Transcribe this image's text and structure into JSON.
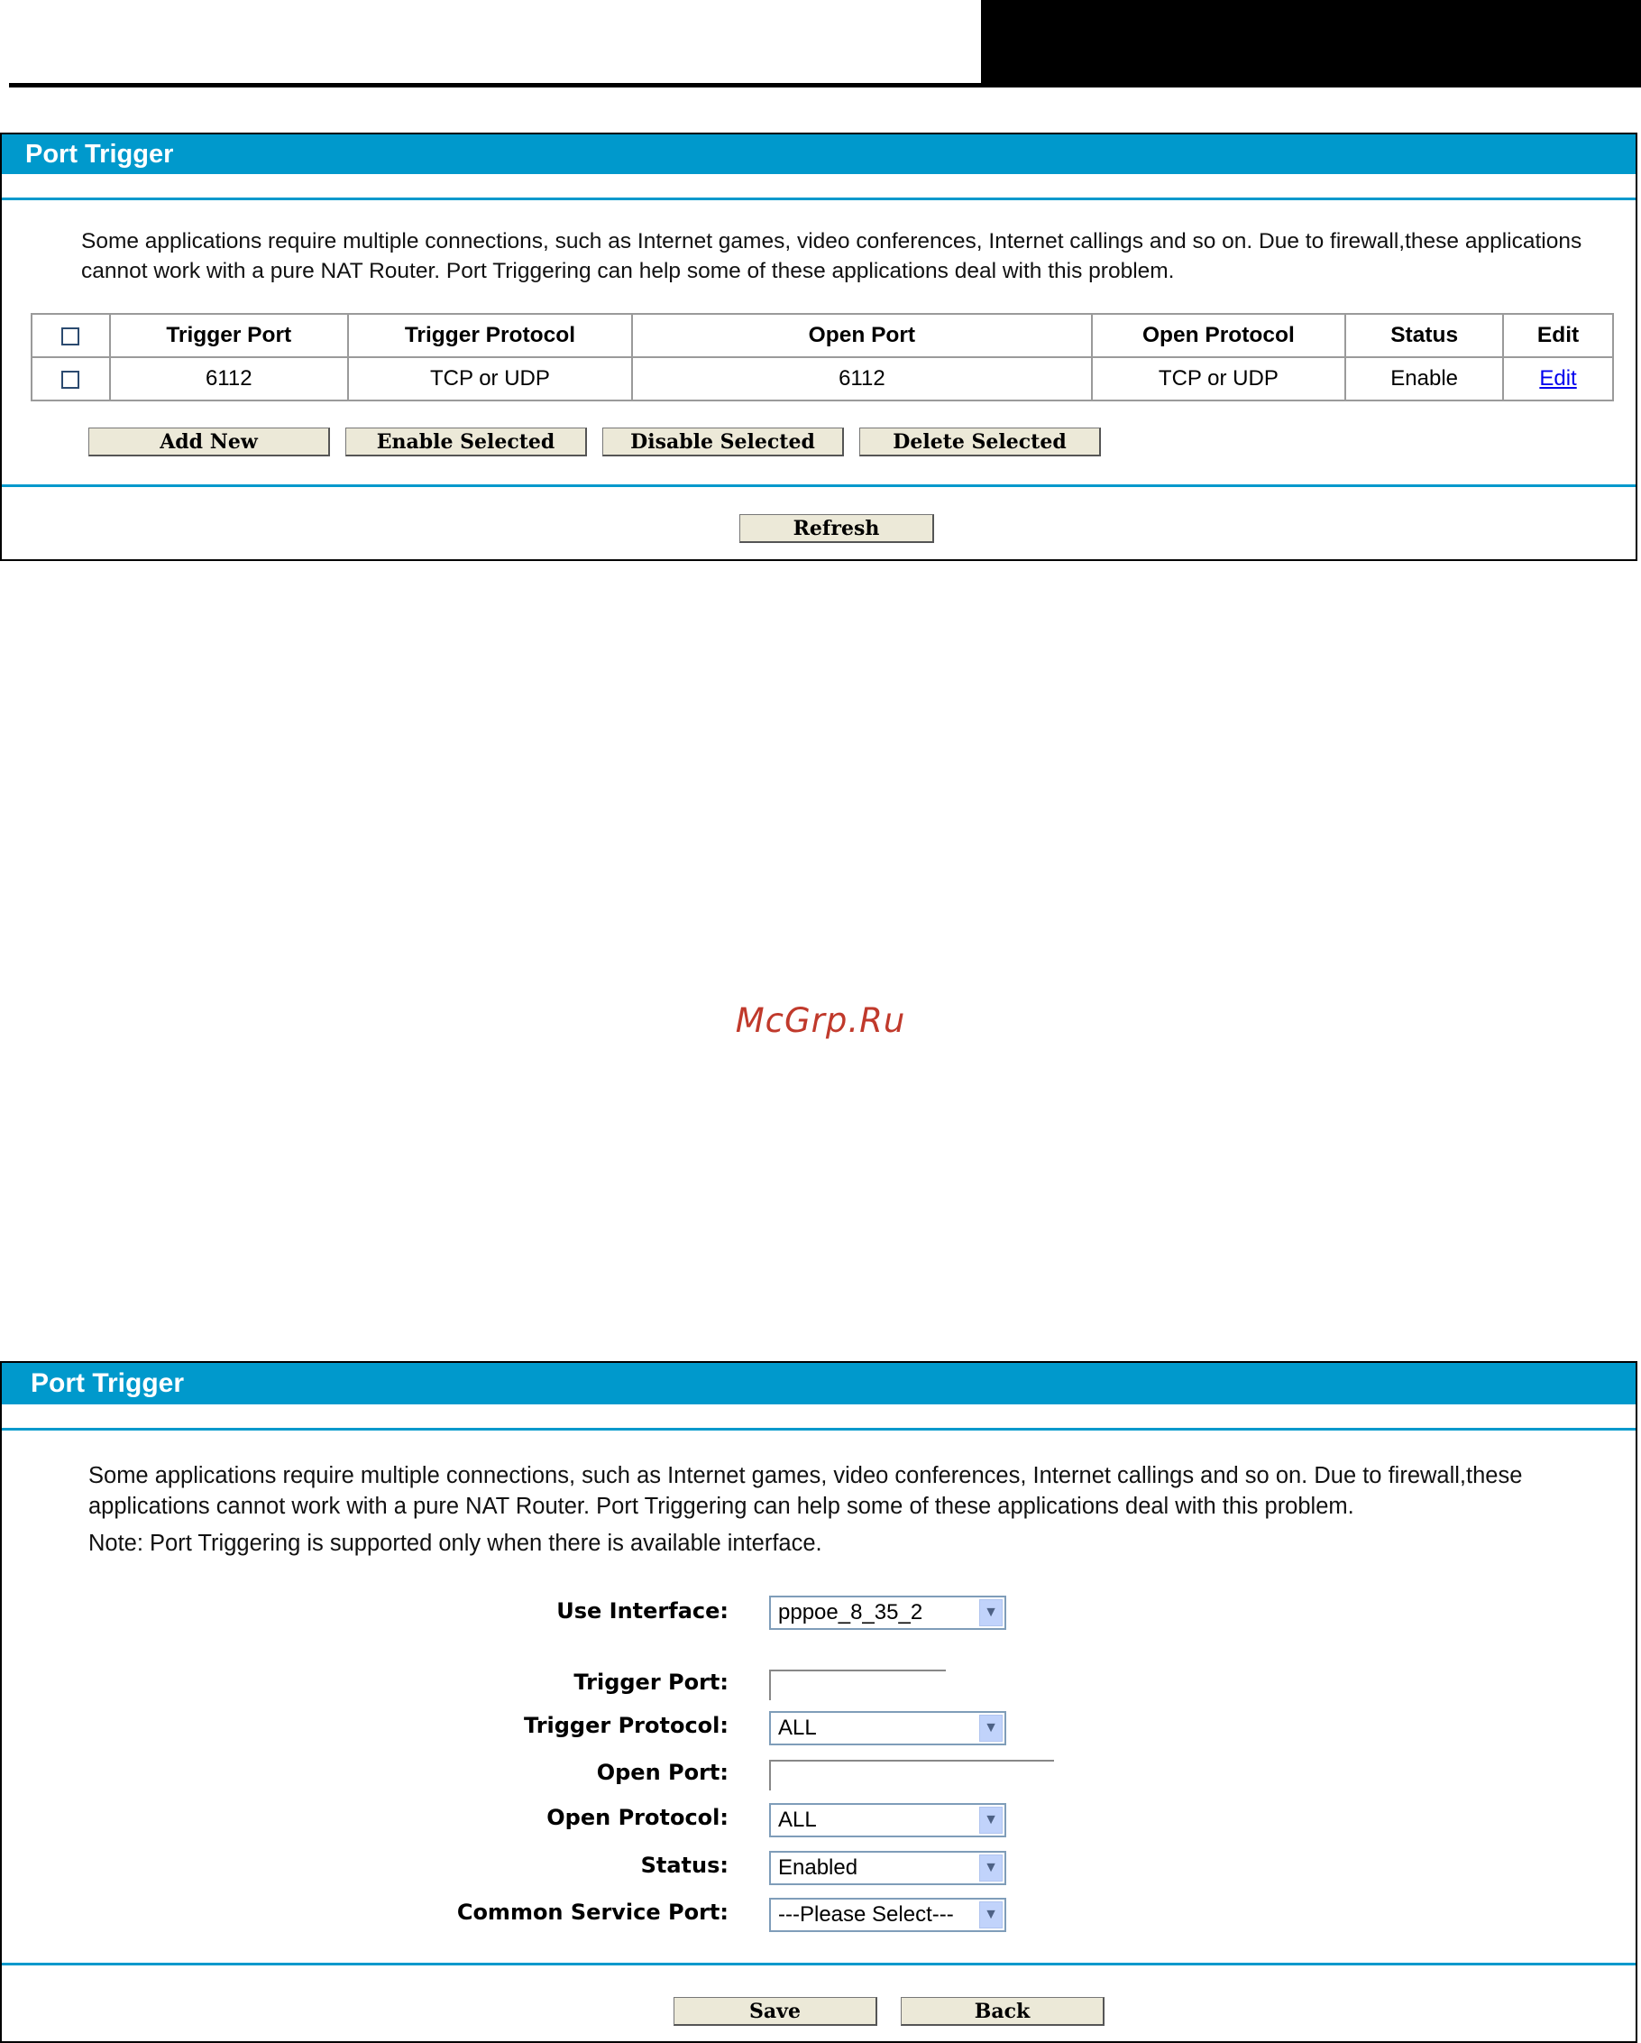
{
  "panel1": {
    "title": "Port Trigger",
    "description": "Some applications require multiple connections, such as Internet games, video conferences, Internet callings and so on. Due to firewall,these applications cannot work with a pure NAT Router. Port Triggering can help some of these applications deal with this problem.",
    "table": {
      "headers": [
        "Trigger Port",
        "Trigger Protocol",
        "Open Port",
        "Open Protocol",
        "Status",
        "Edit"
      ],
      "rows": [
        {
          "trigger_port": "6112",
          "trigger_protocol": "TCP or UDP",
          "open_port": "6112",
          "open_protocol": "TCP or UDP",
          "status": "Enable",
          "edit": "Edit"
        }
      ]
    },
    "buttons": {
      "add_new": "Add New",
      "enable_selected": "Enable Selected",
      "disable_selected": "Disable Selected",
      "delete_selected": "Delete Selected",
      "refresh": "Refresh"
    }
  },
  "watermark": "McGrp.Ru",
  "panel2": {
    "title": "Port Trigger",
    "description": "Some applications require multiple connections, such as Internet games, video conferences, Internet callings and so on. Due to firewall,these applications cannot work with a pure NAT Router. Port Triggering can help some of these applications deal with this problem.",
    "note": "Note: Port Triggering is supported only when there is available interface.",
    "form": {
      "use_interface_label": "Use Interface:",
      "use_interface_value": "pppoe_8_35_2",
      "trigger_port_label": "Trigger Port:",
      "trigger_port_value": "",
      "trigger_protocol_label": "Trigger Protocol:",
      "trigger_protocol_value": "ALL",
      "open_port_label": "Open Port:",
      "open_port_value": "",
      "open_protocol_label": "Open Protocol:",
      "open_protocol_value": "ALL",
      "status_label": "Status:",
      "status_value": "Enabled",
      "common_service_port_label": "Common Service Port:",
      "common_service_port_value": "---Please Select---"
    },
    "buttons": {
      "save": "Save",
      "back": "Back"
    }
  },
  "colors": {
    "header_blue": "#0099cc",
    "link_blue": "#0000ee",
    "button_face": "#ece9d8",
    "watermark_red": "#c0392b"
  },
  "icons": {
    "dropdown": "chevron-down-icon",
    "checkbox": "checkbox-icon"
  }
}
